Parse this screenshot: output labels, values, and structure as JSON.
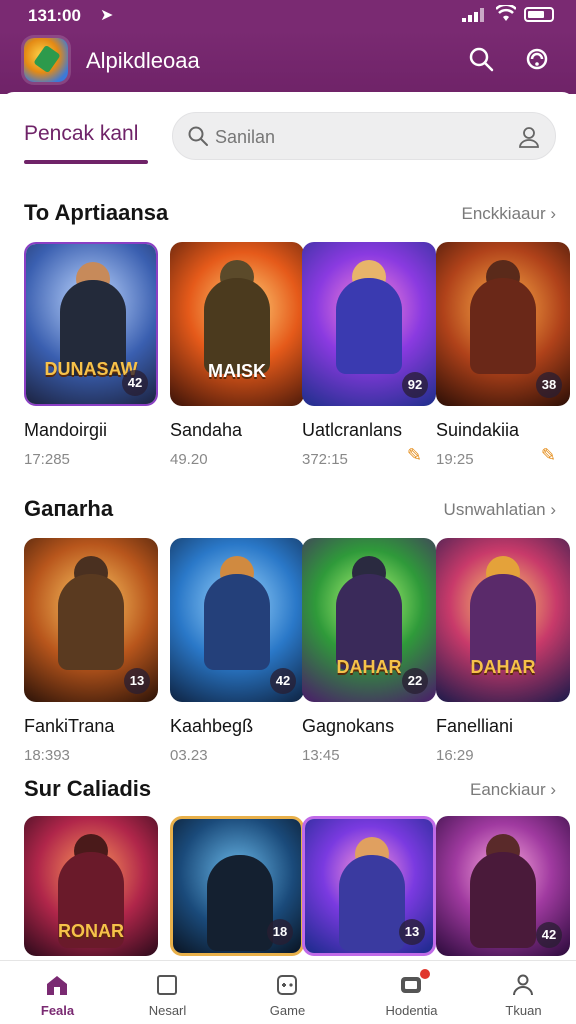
{
  "status": {
    "time": "131:00",
    "nav_arrow": "➤"
  },
  "app": {
    "title": "Alpikdleoaa"
  },
  "colors": {
    "primary": "#7a2a72",
    "active_tab": "#6f2368"
  },
  "tabs": {
    "active": "Pencak kanl"
  },
  "search": {
    "placeholder": "Sanilan"
  },
  "sections": [
    {
      "title": "To Aprtiaansa",
      "more": "Enckkiaaur ›",
      "items": [
        {
          "name": "Mandoirgii",
          "meta": "17:285",
          "badge": "42",
          "banner": "DUNASAW",
          "icon": "",
          "theme": "a"
        },
        {
          "name": "Sandaha",
          "meta": "49.20",
          "badge": "",
          "banner": "MAISK",
          "icon": "",
          "theme": "b"
        },
        {
          "name": "Uatlcranlans",
          "meta": "372:15",
          "badge": "92",
          "banner": "",
          "icon": "✎",
          "theme": "c"
        },
        {
          "name": "Suindakiia",
          "meta": "19:25",
          "badge": "38",
          "banner": "",
          "icon": "✎",
          "theme": "d"
        }
      ]
    },
    {
      "title": "Gaпarha",
      "more": "Usnwahlatian ›",
      "items": [
        {
          "name": "FankiTrana",
          "meta": "18:393",
          "badge": "13",
          "banner": "",
          "icon": "",
          "theme": "e"
        },
        {
          "name": "Kaahbegß",
          "meta": "03.23",
          "badge": "42",
          "banner": "",
          "icon": "",
          "theme": "f"
        },
        {
          "name": "Gagnokans",
          "meta": "13:45",
          "badge": "22",
          "banner": "DAHAR",
          "icon": "",
          "theme": "g"
        },
        {
          "name": "Fanelliani",
          "meta": "16:29",
          "badge": "",
          "banner": "DAHAR",
          "icon": "",
          "theme": "h"
        }
      ]
    },
    {
      "title": "Sur Caliadis",
      "more": "Eanckiaur ›",
      "items": [
        {
          "name": "",
          "meta": "",
          "badge": "",
          "banner": "RONAR",
          "icon": "",
          "theme": "i"
        },
        {
          "name": "",
          "meta": "",
          "badge": "18",
          "banner": "",
          "icon": "",
          "theme": "j"
        },
        {
          "name": "",
          "meta": "",
          "badge": "13",
          "banner": "",
          "icon": "",
          "theme": "k"
        },
        {
          "name": "",
          "meta": "",
          "badge": "42",
          "banner": "",
          "icon": "",
          "theme": "l"
        }
      ]
    }
  ],
  "bottom_nav": [
    {
      "label": "Feala",
      "icon": "home-icon",
      "active": true
    },
    {
      "label": "Nesarl",
      "icon": "square-icon",
      "active": false
    },
    {
      "label": "Game",
      "icon": "gamepad-icon",
      "active": false
    },
    {
      "label": "Hodentia",
      "icon": "store-icon",
      "active": false
    },
    {
      "label": "Tkuan",
      "icon": "person-icon",
      "active": false
    }
  ]
}
